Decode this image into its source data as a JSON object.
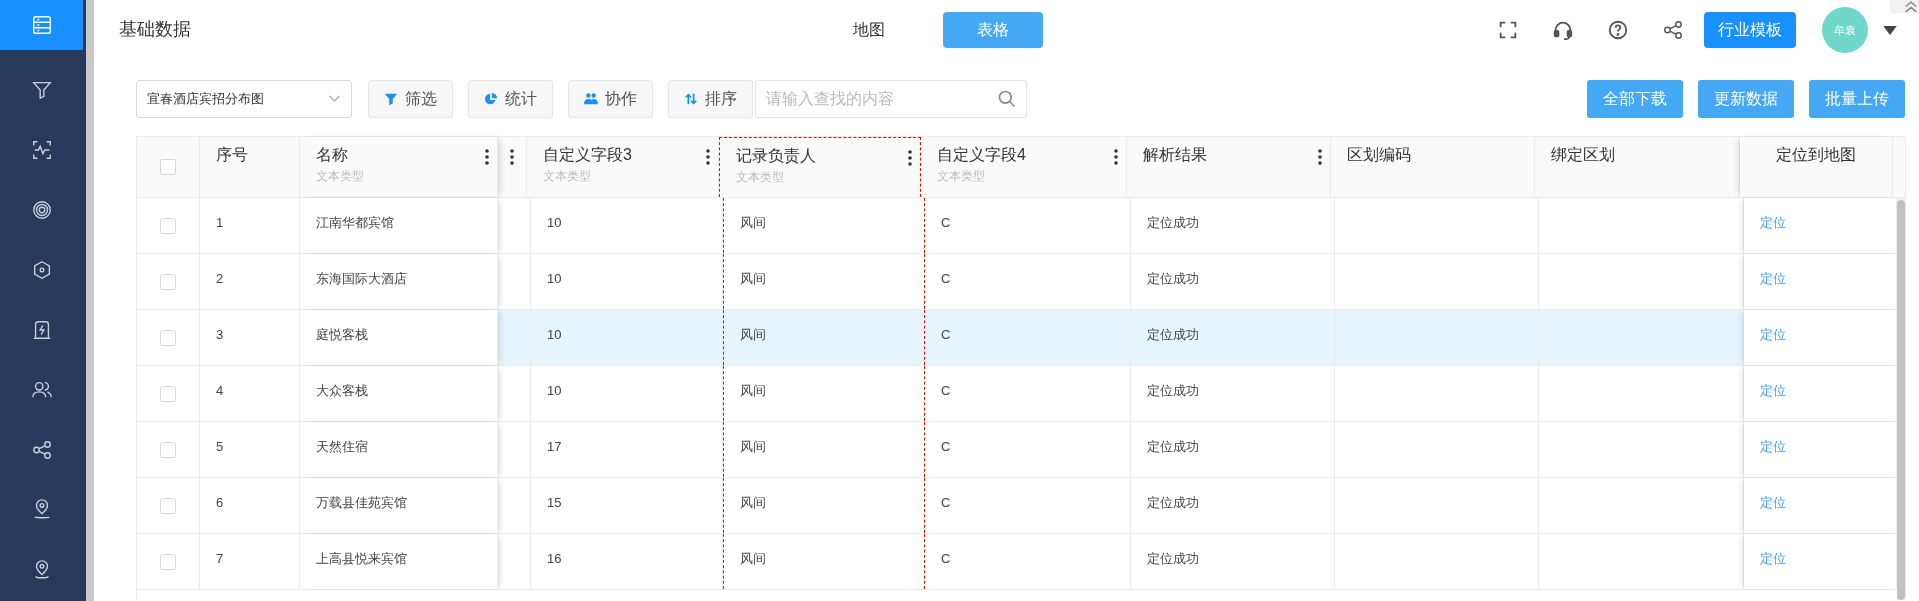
{
  "sidebar": {
    "items": [
      {
        "selected": true
      },
      {
        "selected": false
      },
      {
        "selected": false
      },
      {
        "selected": false
      },
      {
        "selected": false
      },
      {
        "selected": false
      },
      {
        "selected": false
      },
      {
        "selected": false
      },
      {
        "selected": false
      },
      {
        "selected": false
      }
    ]
  },
  "header": {
    "title": "基础数据",
    "view_tabs": [
      {
        "label": "地图",
        "selected": false
      },
      {
        "label": "表格",
        "selected": true
      }
    ],
    "template_button": "行业模板",
    "avatar": "牟袁"
  },
  "toolbar": {
    "dataset_select": "宜春酒店宾招分布图",
    "buttons": [
      {
        "label": "筛选"
      },
      {
        "label": "统计"
      },
      {
        "label": "协作"
      },
      {
        "label": "排序"
      }
    ],
    "search": {
      "placeholder": "请输入查找的内容"
    },
    "actions": [
      "全部下载",
      "更新数据",
      "批量上传"
    ]
  },
  "table": {
    "header_checked": false,
    "columns": [
      {
        "kind": "check",
        "menu": false,
        "highlighted": false
      },
      {
        "kind": "text",
        "label": "序号",
        "menu": false,
        "highlighted": false
      },
      {
        "kind": "text",
        "label": "名称",
        "type": "文本类型",
        "menu": true,
        "highlighted": false
      },
      {
        "kind": "text",
        "menu": true,
        "highlighted": false
      },
      {
        "kind": "text",
        "label": "自定义字段3",
        "type": "文本类型",
        "menu": true,
        "highlighted": false
      },
      {
        "kind": "text",
        "label": "记录负责人",
        "type": "文本类型",
        "menu": true,
        "highlighted": true
      },
      {
        "kind": "text",
        "label": "自定义字段4",
        "type": "文本类型",
        "menu": true,
        "highlighted": false
      },
      {
        "kind": "text",
        "label": "解析结果",
        "menu": true,
        "highlighted": false
      },
      {
        "kind": "text",
        "label": "区划编码",
        "menu": false,
        "highlighted": false
      },
      {
        "kind": "text",
        "label": "绑定区划",
        "menu": false,
        "highlighted": false
      },
      {
        "kind": "link",
        "label": "定位到地图",
        "menu": false,
        "highlighted": false
      }
    ],
    "rows": [
      {
        "checked": false,
        "hovered": false,
        "cells": [
          null,
          "1",
          "江南华都宾馆",
          null,
          "10",
          "风间",
          "C",
          "定位成功",
          null,
          null,
          "定位"
        ]
      },
      {
        "checked": false,
        "hovered": false,
        "cells": [
          null,
          "2",
          "东海国际大酒店",
          null,
          "10",
          "风间",
          "C",
          "定位成功",
          null,
          null,
          "定位"
        ]
      },
      {
        "checked": false,
        "hovered": true,
        "cells": [
          null,
          "3",
          "庭悦客栈",
          null,
          "10",
          "风间",
          "C",
          "定位成功",
          null,
          null,
          "定位"
        ]
      },
      {
        "checked": false,
        "hovered": false,
        "cells": [
          null,
          "4",
          "大众客栈",
          null,
          "10",
          "风间",
          "C",
          "定位成功",
          null,
          null,
          "定位"
        ]
      },
      {
        "checked": false,
        "hovered": false,
        "cells": [
          null,
          "5",
          "天然住宿",
          null,
          "17",
          "风间",
          "C",
          "定位成功",
          null,
          null,
          "定位"
        ]
      },
      {
        "checked": false,
        "hovered": false,
        "cells": [
          null,
          "6",
          "万载县佳苑宾馆",
          null,
          "15",
          "风间",
          "C",
          "定位成功",
          null,
          null,
          "定位"
        ]
      },
      {
        "checked": false,
        "hovered": false,
        "cells": [
          null,
          "7",
          "上高县悦来宾馆",
          null,
          "16",
          "风间",
          "C",
          "定位成功",
          null,
          null,
          "定位"
        ]
      }
    ]
  }
}
